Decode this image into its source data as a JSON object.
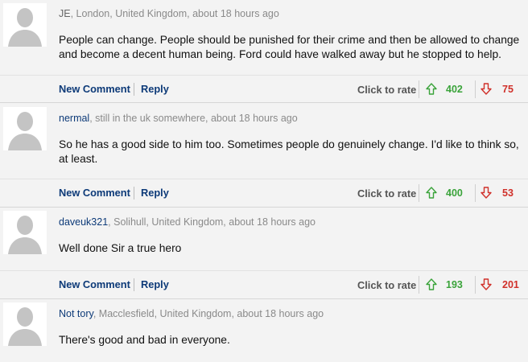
{
  "comments": [
    {
      "username": "JE",
      "location_time": ", London, United Kingdom, about 18 hours ago",
      "text": "People can change. People should be punished for their crime and then be allowed to change and become a decent human being. Ford could have walked away but he stopped to help.",
      "new_comment_label": "New Comment",
      "reply_label": "Reply",
      "rate_label": "Click to rate",
      "upvotes": "402",
      "downvotes": "75",
      "username_linked": false
    },
    {
      "username": "nermal",
      "location_time": ", still in the uk somewhere, about 18 hours ago",
      "text": "So he has a good side to him too. Sometimes people do genuinely change. I'd like to think so, at least.",
      "new_comment_label": "New Comment",
      "reply_label": "Reply",
      "rate_label": "Click to rate",
      "upvotes": "400",
      "downvotes": "53",
      "username_linked": true
    },
    {
      "username": "daveuk321",
      "location_time": ", Solihull, United Kingdom, about 18 hours ago",
      "text": "Well done Sir a true hero",
      "new_comment_label": "New Comment",
      "reply_label": "Reply",
      "rate_label": "Click to rate",
      "upvotes": "193",
      "downvotes": "201",
      "username_linked": true
    },
    {
      "username": "Not tory",
      "location_time": ", Macclesfield, United Kingdom, about 18 hours ago",
      "text": "There's good and bad in everyone.",
      "username_linked": true
    }
  ],
  "colors": {
    "username_link": "#0d3a78",
    "up_vote": "#3aa33a",
    "down_vote": "#d0302a"
  },
  "icons": {
    "avatar": "default-user-silhouette",
    "up": "arrow-up-outline-icon",
    "down": "arrow-down-outline-icon"
  }
}
